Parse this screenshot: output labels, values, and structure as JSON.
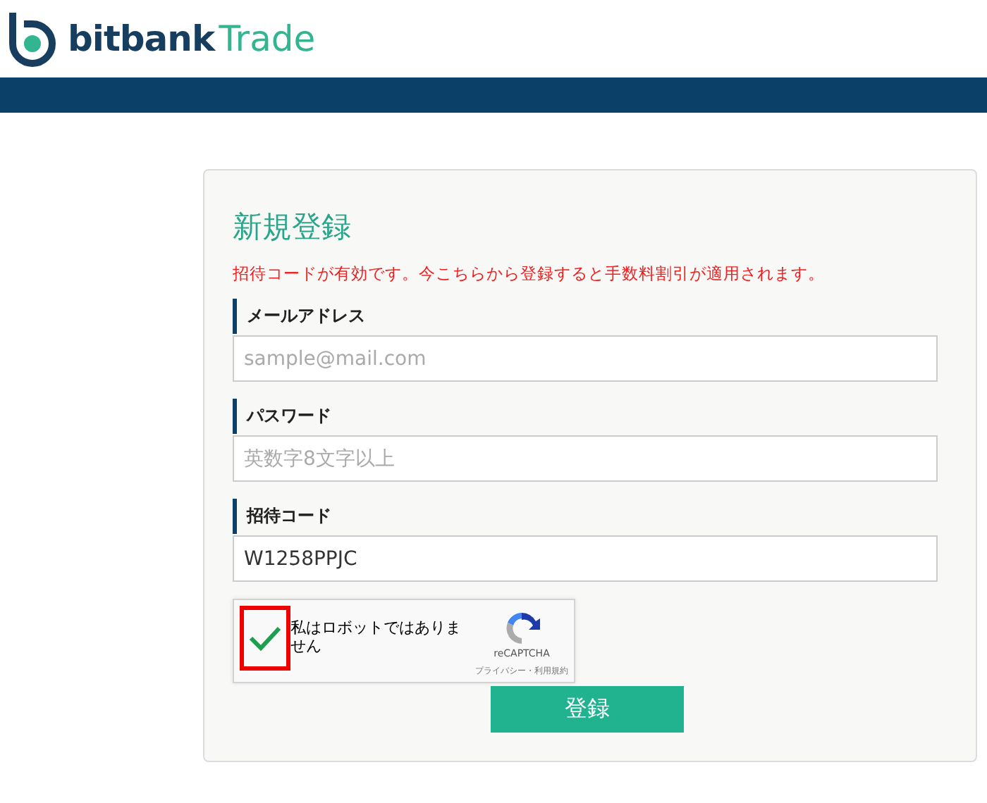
{
  "header": {
    "brand": "bitbank",
    "brand_suffix": "Trade"
  },
  "form": {
    "title": "新規登録",
    "notice": "招待コードが有効です。今こちらから登録すると手数料割引が適用されます。",
    "fields": [
      {
        "label": "メールアドレス",
        "placeholder": "sample@mail.com"
      },
      {
        "label": "パスワード",
        "placeholder": "英数字8文字以上"
      },
      {
        "label": "招待コード",
        "value": "W1258PPJC"
      }
    ],
    "captcha": {
      "label": "私はロボットではありません",
      "checked": true,
      "highlighted": true,
      "brand": "reCAPTCHA",
      "links": "プライバシー・利用規約"
    },
    "submit": "登録"
  }
}
